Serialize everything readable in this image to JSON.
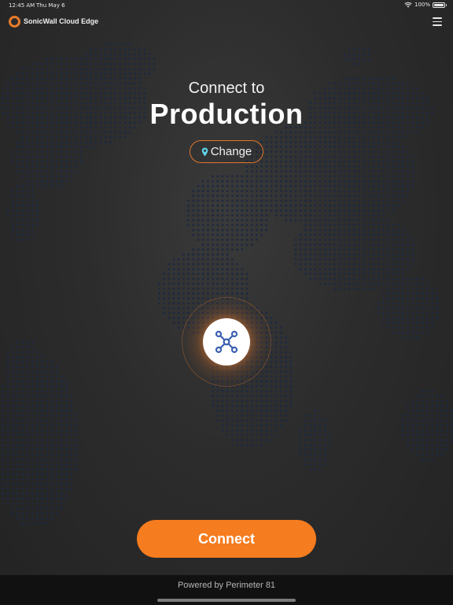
{
  "status_bar": {
    "time": "12:45 AM",
    "date": "Thu May 6",
    "battery": "100%"
  },
  "header": {
    "app_title": "SonicWall Cloud Edge",
    "menu_icon": "hamburger-menu-icon",
    "logo": "sonicwall-logo"
  },
  "main": {
    "connect_to_label": "Connect to",
    "location_name": "Production",
    "change_label": "Change",
    "change_icon": "location-pin-icon",
    "node_icon": "network-nodes-icon",
    "connect_label": "Connect"
  },
  "footer": {
    "powered_by": "Powered by Perimeter 81"
  },
  "colors": {
    "accent": "#f57c1f",
    "pin": "#5fd3e6",
    "node_icon": "#3a5fb0",
    "map_dot": "#1f2a3f",
    "background": "#2c2c2c"
  }
}
